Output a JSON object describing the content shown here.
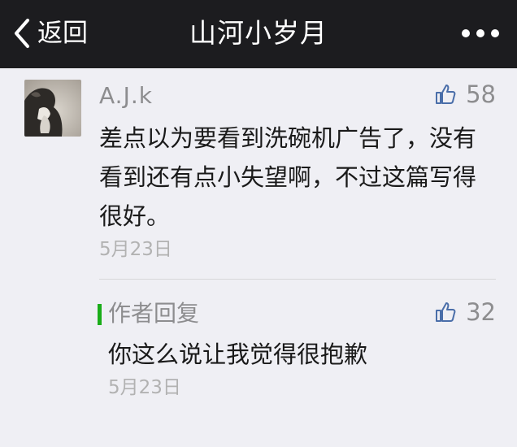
{
  "nav": {
    "back_label": "返回",
    "title": "山河小岁月"
  },
  "comment": {
    "author": "A.J.k",
    "like_count": "58",
    "text": "差点以为要看到洗碗机广告了，没有看到还有点小失望啊，不过这篇写得很好。",
    "date": "5月23日"
  },
  "reply": {
    "label": "作者回复",
    "like_count": "32",
    "text": "你这么说让我觉得很抱歉",
    "date": "5月23日"
  },
  "colors": {
    "nav_bg": "#1c1c1f",
    "page_bg": "#efeff4",
    "reply_accent": "#1aad19",
    "like_icon": "#4a6ea9"
  },
  "icons": {
    "back": "chevron-left-icon",
    "more": "more-dots-icon",
    "like": "thumbs-up-icon"
  }
}
